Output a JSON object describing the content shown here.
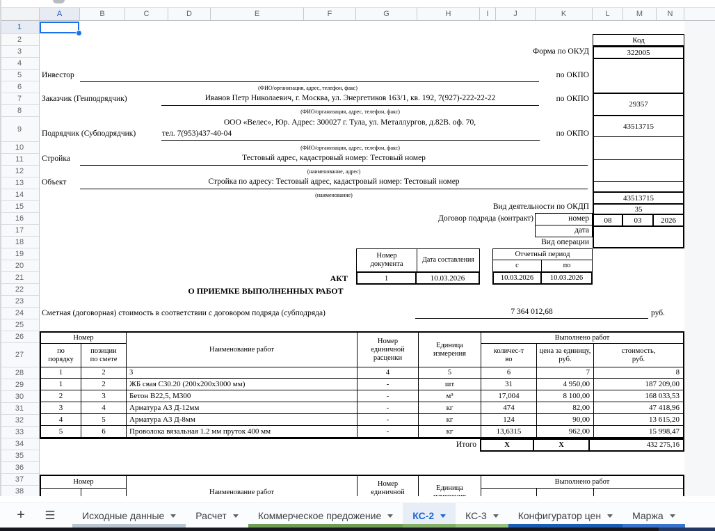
{
  "sheet": {
    "columns": [
      "A",
      "B",
      "C",
      "D",
      "E",
      "F",
      "G",
      "H",
      "I",
      "J",
      "K",
      "L",
      "M",
      "N"
    ],
    "row_count": 38
  },
  "right_column": {
    "kod_header": "Код",
    "okud_value": "322005",
    "okpo_zakazchik": "29357",
    "okpo_podryadchik": "43513715",
    "okdp_value": "43513715",
    "contract_number": "35",
    "date_day": "08",
    "date_month": "03",
    "date_year": "2026"
  },
  "form": {
    "okud_label": "Форма по ОКУД",
    "okpo_label": "по ОКПО",
    "investor_label": "Инвестор",
    "fio_caption": "(ФИО/организация, адрес, телефон, факс)",
    "zakazchik_label": "Заказчик (Генподрядчик)",
    "zakazchik_value": "Иванов Петр Николаевич, г. Москва, ул. Энергетиков 163/1, кв. 192, 7(927)-222-22-22",
    "podryadchik_label": "Подрядчик (Субподрядчик)",
    "podryadchik_value_line1": "ООО «Велес», Юр. Адрес: 300027 г. Тула, ул. Металлургов, д.82В. оф. 70,",
    "podryadchik_value_line2": "тел. 7(953)437-40-04",
    "stroyka_label": "Стройка",
    "stroyka_value": "Тестовый адрес, кадастровый номер: Тестовый номер",
    "stroyka_caption": "(наименование, адрес)",
    "obyekt_label": "Объект",
    "obyekt_value": "Стройка по адресу: Тестовый адрес, кадастровый номер: Тестовый номер",
    "obyekt_caption": "(наименование)",
    "okdp_label": "Вид деятельности по ОКДП",
    "dogovor_label": "Договор подряда (контракт)",
    "nomer_label": "номер",
    "data_label": "дата",
    "vid_operacii_label": "Вид операции",
    "akt_label": "АКТ",
    "doc_number_header": "Номер\nдокумента",
    "doc_date_header": "Дата составления",
    "period_header": "Отчетный период",
    "period_s": "с",
    "period_po": "по",
    "doc_number": "1",
    "doc_date": "10.03.2026",
    "period_from": "10.03.2026",
    "period_to": "10.03.2026",
    "akt_title": "О ПРИЕМКЕ ВЫПОЛНЕННЫХ РАБОТ",
    "smeta_label": "Сметная (договорная) стоимость в соответствии с договором подряда (субподряда)",
    "smeta_value": "7 364 012,68",
    "smeta_currency": "руб."
  },
  "work_table": {
    "header": {
      "nomer": "Номер",
      "po_poryadku": "по\nпорядку",
      "pozicii": "позиции\nпо смете",
      "naimenovanie": "Наименование работ",
      "nomer_rascenki": "Номер\nединичной\nрасценки",
      "edinica": "Единица\nизмерения",
      "vypolneno": "Выполнено работ",
      "kolichestvo": "количес-т\nво",
      "cena": "цена за единицу,\nруб.",
      "stoimost": "стоимость,\nруб."
    },
    "col_numbers": [
      "1",
      "2",
      "3",
      "4",
      "5",
      "6",
      "7",
      "8"
    ],
    "rows": [
      [
        "1",
        "2",
        "ЖБ свая С30.20 (200х200х3000 мм)",
        "-",
        "шт",
        "31",
        "4 950,00",
        "187 209,00"
      ],
      [
        "2",
        "3",
        "Бетон В22,5, М300",
        "-",
        "м³",
        "17,004",
        "8 100,00",
        "168 033,53"
      ],
      [
        "3",
        "4",
        "Арматура А3 Д-12мм",
        "-",
        "кг",
        "474",
        "82,00",
        "47 418,96"
      ],
      [
        "4",
        "5",
        "Арматура А3 Д-8мм",
        "-",
        "кг",
        "124",
        "90,00",
        "13 615,20"
      ],
      [
        "5",
        "6",
        "Проволока вязальная 1.2 мм пруток 400 мм",
        "-",
        "кг",
        "13,6315",
        "962,00",
        "15 998,47"
      ]
    ],
    "itogo": {
      "label": "Итого",
      "qty": "X",
      "price": "X",
      "total": "432 275,16"
    }
  },
  "tabbar": {
    "plus": "+",
    "menu": "☰",
    "tabs": [
      {
        "label": "Исходные данные",
        "strip": "#b9c6d2",
        "active": false
      },
      {
        "label": "Расчет",
        "strip": "",
        "active": false
      },
      {
        "label": "Коммерческое предожение",
        "strip": "#6f9e55",
        "active": false
      },
      {
        "label": "КС-2",
        "strip": "#82b068",
        "active": true
      },
      {
        "label": "КС-3",
        "strip": "#97c17c",
        "active": false
      },
      {
        "label": "Конфигуратор цен",
        "strip": "#1b5cb4",
        "active": false
      },
      {
        "label": "Маржа",
        "strip": "#3a73cc",
        "active": false
      }
    ]
  }
}
